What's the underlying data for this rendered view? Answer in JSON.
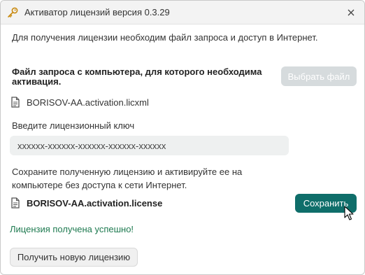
{
  "window": {
    "title": "Активатор лицензий версия 0.3.29",
    "icons": {
      "app": "key-icon",
      "close": "close-icon"
    }
  },
  "intro_text": "Для получения лицензии необходим файл запроса и доступ в Интернет.",
  "request_section": {
    "label_line1": "Файл запроса с компьютера, для которого необходима",
    "label_line2": "активация.",
    "select_file_button": "Выбрать файл",
    "file_name": "BORISOV-AA.activation.licxml"
  },
  "license_key": {
    "label": "Введите лицензионный ключ",
    "value": "xxxxxx-xxxxxx-xxxxxx-xxxxxx-xxxxxx"
  },
  "save_section": {
    "text_line1": "Сохраните полученную лицензию и активируйте ее на",
    "text_line2": "компьютере без доступа к сети Интернет.",
    "file_name": "BORISOV-AA.activation.license",
    "save_button": "Сохранить"
  },
  "status": "Лицензия получена успешно!",
  "new_license_button": "Получить новую лицензию",
  "colors": {
    "accent": "#0f6e6a",
    "success": "#1e7a50",
    "disabled": "#d6dbdd"
  }
}
